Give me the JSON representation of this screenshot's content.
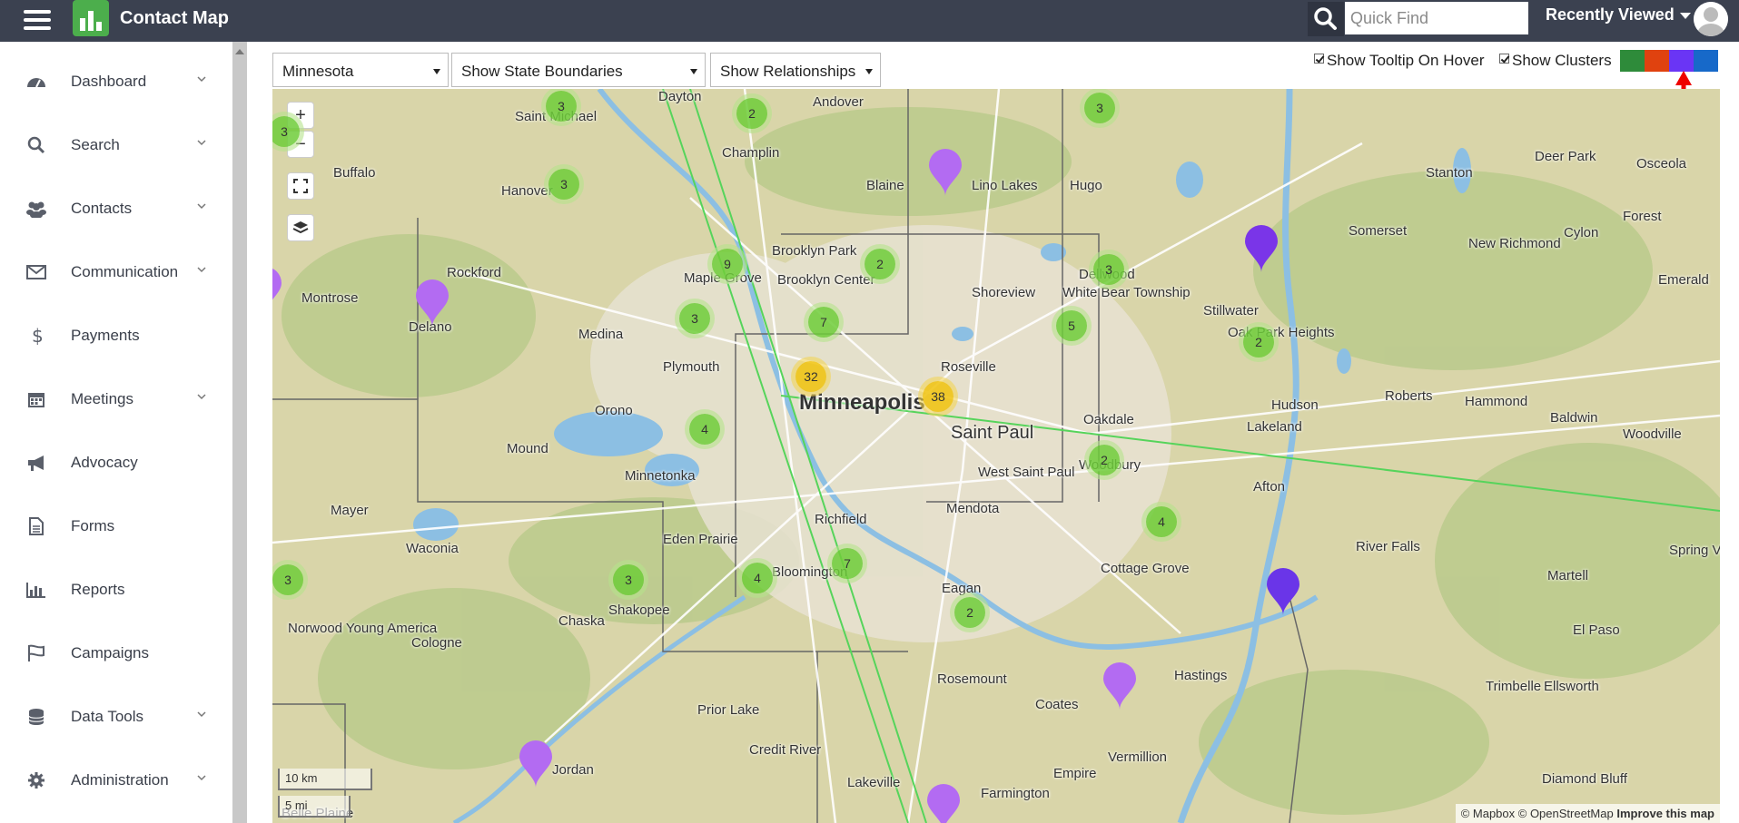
{
  "header": {
    "app_title": "Contact Map",
    "search_placeholder": "Quick Find",
    "recently_viewed": "Recently Viewed"
  },
  "sidebar": {
    "items": [
      {
        "label": "Dashboard",
        "icon": "dashboard-icon",
        "has_submenu": true
      },
      {
        "label": "Search",
        "icon": "search-icon",
        "has_submenu": true
      },
      {
        "label": "Contacts",
        "icon": "contacts-icon",
        "has_submenu": true
      },
      {
        "label": "Communication",
        "icon": "envelope-icon",
        "has_submenu": true
      },
      {
        "label": "Payments",
        "icon": "dollar-icon",
        "has_submenu": false
      },
      {
        "label": "Meetings",
        "icon": "calendar-icon",
        "has_submenu": true
      },
      {
        "label": "Advocacy",
        "icon": "megaphone-icon",
        "has_submenu": false
      },
      {
        "label": "Forms",
        "icon": "document-icon",
        "has_submenu": false
      },
      {
        "label": "Reports",
        "icon": "bar-chart-icon",
        "has_submenu": false
      },
      {
        "label": "Campaigns",
        "icon": "flag-icon",
        "has_submenu": false
      },
      {
        "label": "Data Tools",
        "icon": "database-icon",
        "has_submenu": true
      },
      {
        "label": "Administration",
        "icon": "gear-icon",
        "has_submenu": true
      }
    ]
  },
  "toolbar": {
    "state_select": "Minnesota",
    "boundaries_select": "Show State Boundaries",
    "relationships_select": "Show Relationships",
    "tooltip_checkbox": "Show Tooltip On Hover",
    "clusters_checkbox": "Show Clusters",
    "color_swatches": [
      "#2e8b3a",
      "#e0420f",
      "#6a35f5",
      "#1769c9"
    ]
  },
  "map": {
    "zoom_in": "+",
    "zoom_out": "−",
    "scale_km": "10 km",
    "scale_mi": "5 mi",
    "attribution": "© Mapbox © OpenStreetMap",
    "improve": "Improve this map",
    "clusters": [
      "3",
      "2",
      "3",
      "3",
      "9",
      "2",
      "3",
      "3",
      "5",
      "7",
      "2",
      "3",
      "32",
      "38",
      "4",
      "2",
      "4",
      "7",
      "3",
      "4",
      "2",
      "3"
    ],
    "places": [
      "Dayton",
      "Andover",
      "Saint Michael",
      "Champlin",
      "Blaine",
      "Lino Lakes",
      "Hugo",
      "Buffalo",
      "Hanover",
      "Brooklyn Park",
      "Brooklyn Center",
      "Maple Grove",
      "Shoreview",
      "Dellwood",
      "White Bear Township",
      "Rockford",
      "Montrose",
      "Delano",
      "Medina",
      "Plymouth",
      "Roseville",
      "Stillwater",
      "Oak Park Heights",
      "Minneapolis",
      "Saint Paul",
      "Oakdale",
      "Orono",
      "Mound",
      "Minnetonka",
      "West Saint Paul",
      "Mendota",
      "Woodbury",
      "Richfield",
      "Mayer",
      "Eden Prairie",
      "Bloomington",
      "Waconia",
      "Eagan",
      "Cottage Grove",
      "Chaska",
      "Shakopee",
      "Norwood Young America",
      "Cologne",
      "Prior Lake",
      "Rosemount",
      "Coates",
      "Hastings",
      "Credit River",
      "Vermillion",
      "Empire",
      "Lakeville",
      "Jordan",
      "Farmington",
      "Belle Plaine",
      "Hudson",
      "Lakeland",
      "Afton",
      "Roberts",
      "Hammond",
      "Baldwin",
      "Woodville",
      "River Falls",
      "Martell",
      "El Paso",
      "Trimbelle",
      "Ellsworth",
      "Diamond Bluff",
      "Stanton",
      "Deer Park",
      "New Richmond",
      "Somerset",
      "Cylon",
      "Forest",
      "Emerald",
      "Spring Valley",
      "Osceola"
    ]
  }
}
